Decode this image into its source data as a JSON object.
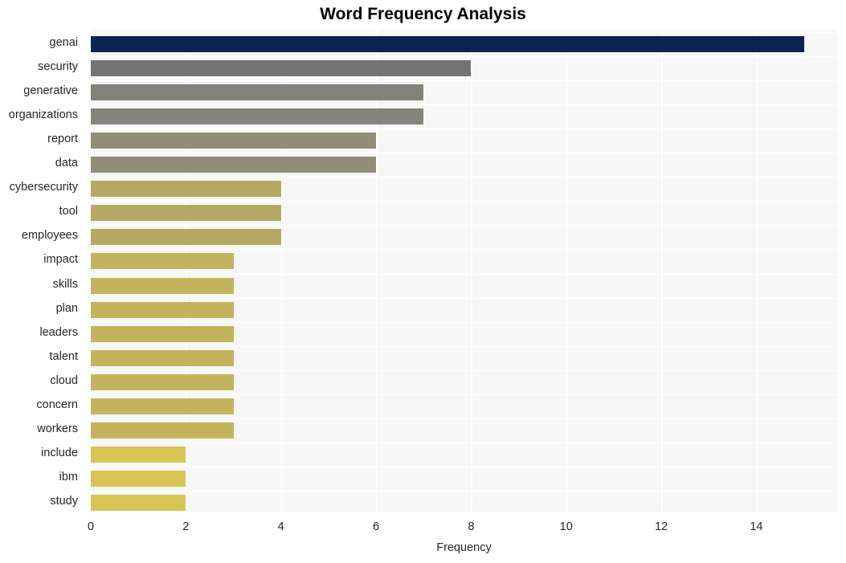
{
  "chart_data": {
    "type": "bar",
    "orientation": "horizontal",
    "title": "Word Frequency Analysis",
    "xlabel": "Frequency",
    "ylabel": "",
    "xlim": [
      0,
      15.7
    ],
    "xticks": [
      "0",
      "2",
      "4",
      "6",
      "8",
      "10",
      "12",
      "14"
    ],
    "xtick_values": [
      0,
      2,
      4,
      6,
      8,
      10,
      12,
      14
    ],
    "grid": "vertical-white-on-light-gray",
    "legend": "none",
    "categories": [
      "genai",
      "security",
      "generative",
      "organizations",
      "report",
      "data",
      "cybersecurity",
      "tool",
      "employees",
      "impact",
      "skills",
      "plan",
      "leaders",
      "talent",
      "cloud",
      "concern",
      "workers",
      "include",
      "ibm",
      "study"
    ],
    "values": [
      15,
      8,
      7,
      7,
      6,
      6,
      4,
      4,
      4,
      3,
      3,
      3,
      3,
      3,
      3,
      3,
      3,
      2,
      2,
      2
    ],
    "bar_colors": [
      "#0a2351",
      "#737373",
      "#83817a",
      "#86847b",
      "#918d76",
      "#918d76",
      "#b5a963",
      "#b5a963",
      "#b5a963",
      "#c3b35d",
      "#c3b35d",
      "#c3b35d",
      "#c3b35d",
      "#c3b35d",
      "#c3b35d",
      "#c3b35d",
      "#c3b35d",
      "#d8c455",
      "#d8c455",
      "#d8c455"
    ]
  },
  "colors": {
    "plot_background": "#f7f7f7",
    "figure_background": "#ffffff",
    "gridline": "#ffffff",
    "text": "#262626",
    "title": "#000000",
    "accent_high": "#0a2351",
    "accent_low": "#d8c455"
  }
}
